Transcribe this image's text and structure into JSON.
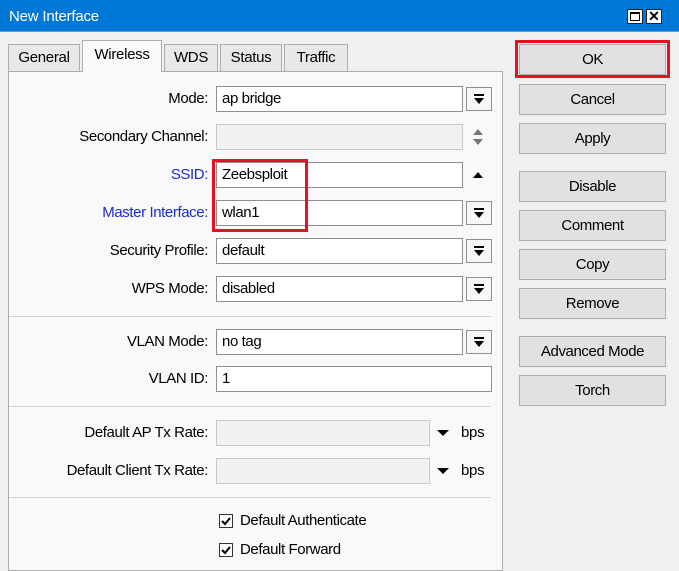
{
  "window": {
    "title": "New Interface"
  },
  "tabs": [
    "General",
    "Wireless",
    "WDS",
    "Status",
    "Traffic"
  ],
  "form": {
    "mode": {
      "label": "Mode:",
      "value": "ap bridge"
    },
    "secondary_channel": {
      "label": "Secondary Channel:",
      "value": ""
    },
    "ssid": {
      "label": "SSID:",
      "value": "Zeebsploit"
    },
    "master_interface": {
      "label": "Master Interface:",
      "value": "wlan1"
    },
    "security_profile": {
      "label": "Security Profile:",
      "value": "default"
    },
    "wps_mode": {
      "label": "WPS Mode:",
      "value": "disabled"
    },
    "vlan_mode": {
      "label": "VLAN Mode:",
      "value": "no tag"
    },
    "vlan_id": {
      "label": "VLAN ID:",
      "value": "1"
    },
    "default_ap_tx_rate": {
      "label": "Default AP Tx Rate:",
      "value": "",
      "unit": "bps"
    },
    "default_client_tx_rate": {
      "label": "Default Client Tx Rate:",
      "value": "",
      "unit": "bps"
    },
    "default_authenticate": {
      "label": "Default Authenticate",
      "checked": true
    },
    "default_forward": {
      "label": "Default Forward",
      "checked": true
    }
  },
  "buttons": {
    "ok": "OK",
    "cancel": "Cancel",
    "apply": "Apply",
    "disable": "Disable",
    "comment": "Comment",
    "copy": "Copy",
    "remove": "Remove",
    "advanced_mode": "Advanced Mode",
    "torch": "Torch"
  },
  "colors": {
    "titlebar": "#0078d7",
    "highlight": "#e81123",
    "blue_label": "#1a2bd0"
  },
  "icons": {
    "maximize": "maximize-icon",
    "close": "close-icon",
    "dropdown": "dropdown-arrow-icon"
  }
}
